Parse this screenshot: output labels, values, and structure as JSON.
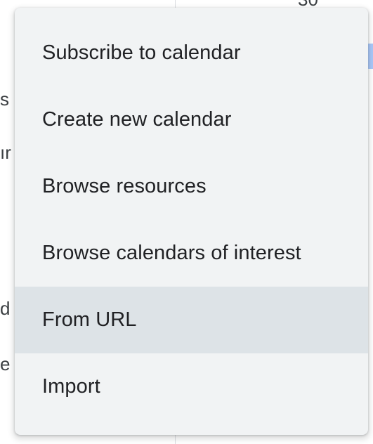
{
  "background": {
    "date_number": "30",
    "fragments": [
      "s",
      "ır",
      "d",
      "e"
    ]
  },
  "menu": {
    "items": [
      {
        "label": "Subscribe to calendar"
      },
      {
        "label": "Create new calendar"
      },
      {
        "label": "Browse resources"
      },
      {
        "label": "Browse calendars of interest"
      },
      {
        "label": "From URL",
        "highlighted": true
      },
      {
        "label": "Import"
      }
    ]
  },
  "colors": {
    "menu_background": "#f1f3f4",
    "highlight_background": "#dde3e7",
    "text": "#202124",
    "event_chip": "#a8c7fa"
  }
}
